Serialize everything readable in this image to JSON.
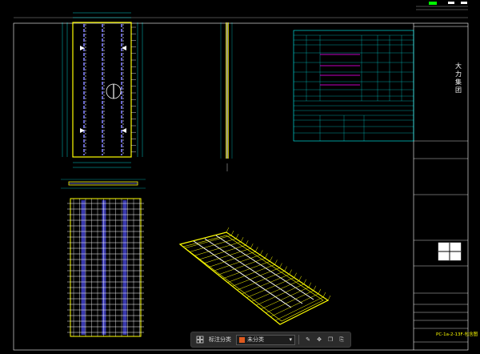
{
  "title_block": {
    "company_vertical": "大力集团",
    "drawing_code": "PC-1a-2-13F-包含图"
  },
  "toolbar": {
    "label": "标注分类",
    "select_value": "未分类",
    "swatch_color": "#e05a1e",
    "icons": [
      "layers-icon",
      "chevron-down-icon",
      "edit-icon",
      "move-icon",
      "copy-icon",
      "paste-icon"
    ]
  },
  "colors": {
    "background": "#000000",
    "frame": "#ffffff",
    "outline": "#ffff00",
    "rebar": "#8080ff",
    "rebar_dark": "#4040c0",
    "dimension": "#00ffff",
    "table_text": "#00ffff",
    "highlight": "#ff00ff",
    "green": "#00ff00"
  }
}
